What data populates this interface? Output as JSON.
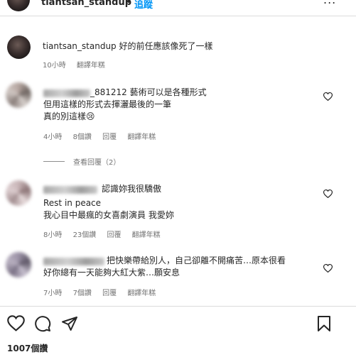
{
  "header": {
    "username": "tiantsan_standup",
    "separator": "•",
    "follow_label": "追蹤",
    "more": "..."
  },
  "caption": {
    "username": "tiantsan_standup",
    "text": "好的前任應該像死了一樣",
    "time": "10小時",
    "translate": "翻譯年糕"
  },
  "comments": [
    {
      "username_visible": "_881212",
      "line1": "藝術可以是各種形式",
      "line2": "但用這樣的形式去揮灑最後的一筆",
      "line3": "真的別這樣😢",
      "time": "4小時",
      "likes": "8個讚",
      "reply": "回覆",
      "translate": "翻譯年糕",
      "view_replies": "查看回覆（2）"
    },
    {
      "line1": "認識妳我很驕傲",
      "line2": "Rest in peace",
      "line3": "我心目中最瘋的女喜劇演員 我愛妳",
      "time": "8小時",
      "likes": "23個讚",
      "reply": "回覆",
      "translate": "翻譯年糕"
    },
    {
      "line1": "把快樂帶給別人，自己卻離不開痛苦…原本很看",
      "line2": "好你總有一天能夠大紅大紫…願安息",
      "time": "7小時",
      "likes": "7個讚",
      "reply": "回覆",
      "translate": "翻譯年糕"
    }
  ],
  "actions": {
    "like_icon": "heart-icon",
    "comment_icon": "comment-icon",
    "share_icon": "send-icon",
    "save_icon": "bookmark-icon"
  },
  "likes_count": "1007個讚",
  "colors": {
    "link_blue": "#0095f6",
    "meta_gray": "#737373",
    "divider": "#dbdbdb"
  }
}
